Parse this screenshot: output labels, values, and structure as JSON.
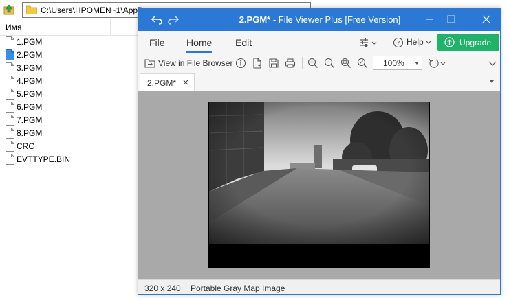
{
  "explorer": {
    "address_path": "C:\\Users\\HPOMEN~1\\AppD",
    "column_name": "Имя",
    "files": [
      {
        "name": "1.PGM",
        "selected": false
      },
      {
        "name": "2.PGM",
        "selected": true
      },
      {
        "name": "3.PGM",
        "selected": false
      },
      {
        "name": "4.PGM",
        "selected": false
      },
      {
        "name": "5.PGM",
        "selected": false
      },
      {
        "name": "6.PGM",
        "selected": false
      },
      {
        "name": "7.PGM",
        "selected": false
      },
      {
        "name": "8.PGM",
        "selected": false
      },
      {
        "name": "CRC",
        "selected": false
      },
      {
        "name": "EVTTYPE.BIN",
        "selected": false
      }
    ]
  },
  "viewer": {
    "title_file": "2.PGM*",
    "title_rest": " - File Viewer Plus [Free Version]",
    "menu": {
      "file": "File",
      "home": "Home",
      "edit": "Edit"
    },
    "help_label": "Help",
    "upgrade_label": "Upgrade",
    "toolbar": {
      "view_in_browser": "View in File Browser",
      "zoom": "100%"
    },
    "doc_tab": "2.PGM*",
    "status": {
      "dimensions": "320 x 240",
      "type": "Portable Gray Map Image"
    }
  },
  "colors": {
    "titlebar": "#2b79d4",
    "upgrade": "#21b26a",
    "viewport_bg": "#a9a9a9"
  }
}
